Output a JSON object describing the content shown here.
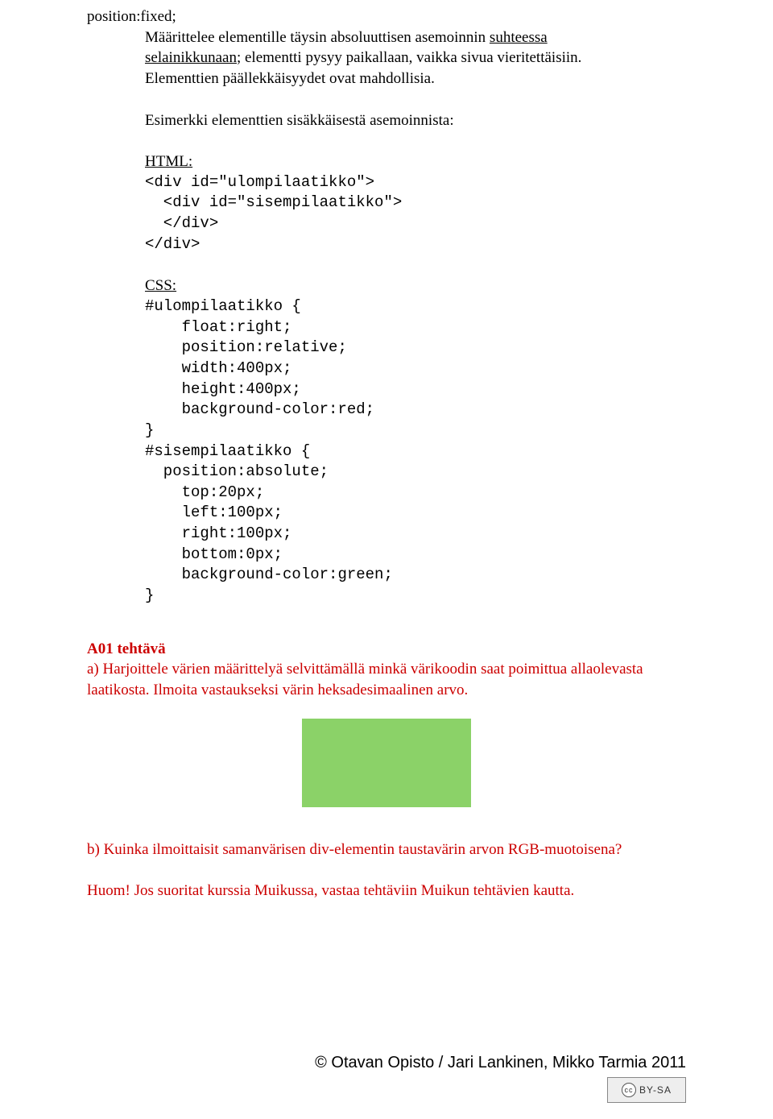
{
  "p1": {
    "line1": "position:fixed;",
    "line2a": "Määrittelee elementille täysin absoluuttisen asemoinnin ",
    "line2b": "suhteessa",
    "line3a": "selainikkunaan",
    "line3b": "; elementti pysyy paikallaan, vaikka sivua vieritettäisiin.",
    "line4": "Elementtien päällekkäisyydet ovat mahdollisia."
  },
  "p2": "Esimerkki elementtien sisäkkäisestä asemoinnista:",
  "html_label": "HTML:",
  "html_code": "<div id=\"ulompilaatikko\">\n  <div id=\"sisempilaatikko\">\n  </div>\n</div>",
  "css_label": "CSS:",
  "css_code": "#ulompilaatikko {\n    float:right;\n    position:relative;\n    width:400px;\n    height:400px;\n    background-color:red;\n}\n#sisempilaatikko {\n  position:absolute;\n    top:20px;\n    left:100px;\n    right:100px;\n    bottom:0px;\n    background-color:green;\n}",
  "task": {
    "heading": "A01 tehtävä",
    "a": "a) Harjoittele värien määrittelyä selvittämällä minkä värikoodin saat poimittua allaolevasta laatikosta. Ilmoita vastaukseksi värin heksadesimaalinen arvo.",
    "b": "b) Kuinka ilmoittaisit samanvärisen div-elementin taustavärin arvon RGB-muotoisena?",
    "note": "Huom! Jos suoritat kurssia Muikussa, vastaa tehtäviin Muikun tehtävien kautta."
  },
  "footer": "© Otavan Opisto / Jari Lankinen, Mikko Tarmia 2011",
  "cc": "BY-SA"
}
